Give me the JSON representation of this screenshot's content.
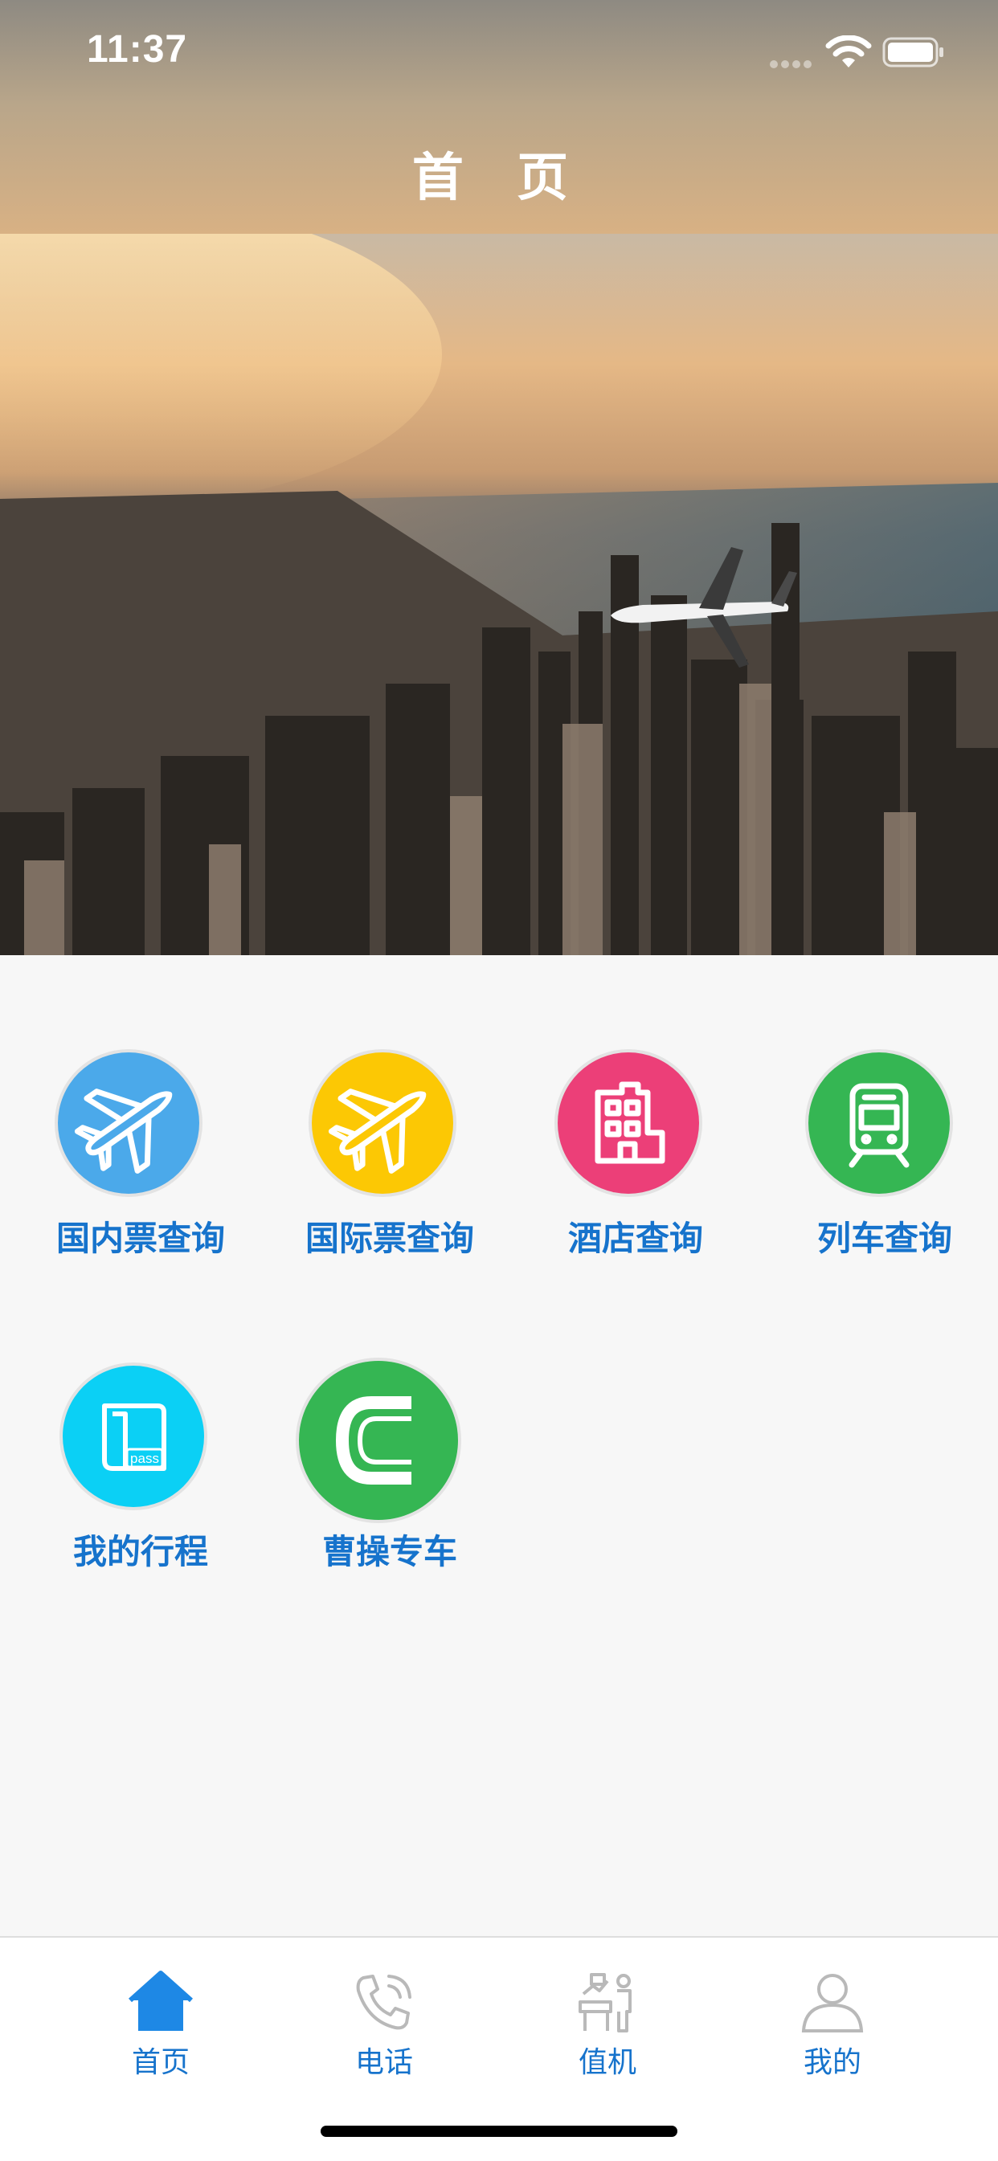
{
  "status_bar": {
    "time": "11:37"
  },
  "header": {
    "title": "首 页"
  },
  "menu": {
    "items": [
      {
        "label": "国内票查询",
        "icon": "airplane-icon",
        "color": "#4ba9ea"
      },
      {
        "label": "国际票查询",
        "icon": "airplane-icon",
        "color": "#fcc804"
      },
      {
        "label": "酒店查询",
        "icon": "hotel-icon",
        "color": "#ec3f78"
      },
      {
        "label": "列车查询",
        "icon": "train-icon",
        "color": "#35b653"
      },
      {
        "label": "我的行程",
        "icon": "pass-icon",
        "color": "#0bd0f5",
        "badge": "pass"
      },
      {
        "label": "曹操专车",
        "icon": "caocao-logo-icon",
        "color": "#35b653"
      }
    ]
  },
  "tabbar": {
    "tabs": [
      {
        "label": "首页",
        "icon": "home-icon",
        "active": true
      },
      {
        "label": "电话",
        "icon": "phone-icon",
        "active": false
      },
      {
        "label": "值机",
        "icon": "checkin-icon",
        "active": false
      },
      {
        "label": "我的",
        "icon": "user-icon",
        "active": false
      }
    ]
  },
  "colors": {
    "accent": "#1673cc",
    "tab_active_icon": "#1e88e5",
    "tab_inactive_icon": "#b9b9b9",
    "background": "#f7f7f7"
  }
}
